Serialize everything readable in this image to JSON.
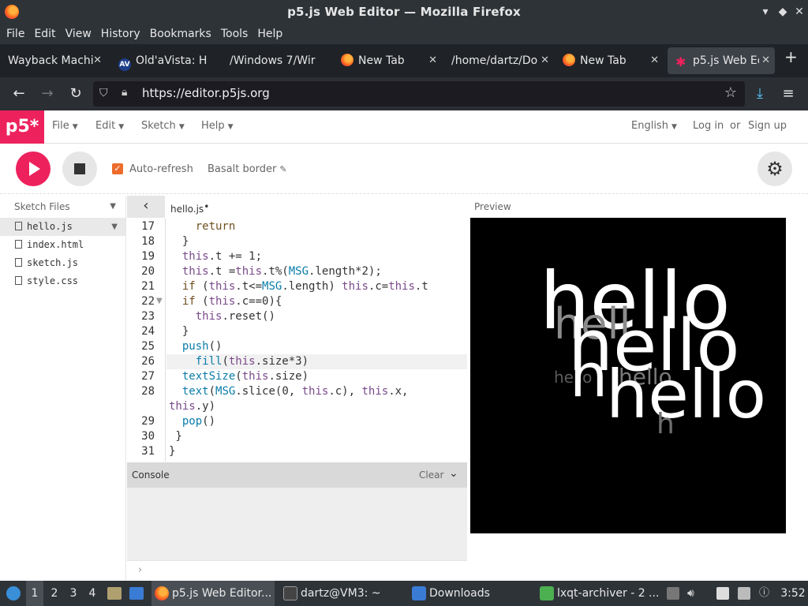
{
  "window": {
    "title": "p5.js Web Editor — Mozilla Firefox"
  },
  "menubar": [
    "File",
    "Edit",
    "View",
    "History",
    "Bookmarks",
    "Tools",
    "Help"
  ],
  "tabs": [
    {
      "label": "Wayback Machi",
      "favicon": "none"
    },
    {
      "label": "Old'aVista: H",
      "favicon": "av"
    },
    {
      "label": "/Windows 7/Wir",
      "favicon": "none"
    },
    {
      "label": "New Tab",
      "favicon": "firefox"
    },
    {
      "label": "/home/dartz/Do",
      "favicon": "none"
    },
    {
      "label": "New Tab",
      "favicon": "firefox"
    },
    {
      "label": "p5.js Web Ed",
      "favicon": "p5",
      "active": true
    }
  ],
  "url": "https://editor.p5js.org",
  "p5header": {
    "logo": "p5*",
    "menus": [
      "File",
      "Edit",
      "Sketch",
      "Help"
    ],
    "language": "English",
    "login": "Log in",
    "or": "or",
    "signup": "Sign up"
  },
  "toolbar": {
    "auto_refresh_label": "Auto-refresh",
    "auto_refresh_checked": true,
    "sketch_name": "Basalt border"
  },
  "sidebar": {
    "title": "Sketch Files",
    "files": [
      {
        "name": "hello.js",
        "selected": true
      },
      {
        "name": "index.html",
        "selected": false
      },
      {
        "name": "sketch.js",
        "selected": false
      },
      {
        "name": "style.css",
        "selected": false
      }
    ]
  },
  "editor": {
    "filename": "hello.js",
    "unsaved_marker": "•",
    "lines": [
      {
        "n": "17",
        "text": "    return"
      },
      {
        "n": "18",
        "text": "  }"
      },
      {
        "n": "19",
        "text": "  this.t += 1;"
      },
      {
        "n": "20",
        "text": "  this.t =this.t%(MSG.length*2);"
      },
      {
        "n": "21",
        "text": "  if (this.t<=MSG.length) this.c=this.t"
      },
      {
        "n": "22",
        "text": "  if (this.c==0){"
      },
      {
        "n": "23",
        "text": "    this.reset()"
      },
      {
        "n": "24",
        "text": "  }"
      },
      {
        "n": "25",
        "text": "  push()"
      },
      {
        "n": "26",
        "text": "    fill(this.size*3)"
      },
      {
        "n": "27",
        "text": "  textSize(this.size)"
      },
      {
        "n": "28",
        "text": "  text(MSG.slice(0, this.c), this.x,"
      },
      {
        "n": "",
        "text": "this.y)"
      },
      {
        "n": "29",
        "text": "  pop()"
      },
      {
        "n": "30",
        "text": " }"
      },
      {
        "n": "31",
        "text": "}"
      }
    ]
  },
  "console": {
    "title": "Console",
    "clear_label": "Clear",
    "prompt": "›"
  },
  "preview": {
    "label": "Preview",
    "texts": [
      {
        "text": "hello",
        "shade": "#ffffff"
      },
      {
        "text": "hell",
        "shade": "#8c8c8c"
      },
      {
        "text": "hello",
        "shade": "#ffffff"
      },
      {
        "text": "hello",
        "shade": "#5a5a5a"
      },
      {
        "text": "hello",
        "shade": "#7a7a7a"
      },
      {
        "text": "h",
        "shade": "#ffffff"
      },
      {
        "text": "hello",
        "shade": "#ffffff"
      },
      {
        "text": "h",
        "shade": "#6e6e6e"
      }
    ]
  },
  "taskbar": {
    "workspaces": [
      "1",
      "2",
      "3",
      "4"
    ],
    "windows": [
      {
        "label": "p5.js Web Editor...",
        "active": true
      },
      {
        "label": "dartz@VM3: ~"
      },
      {
        "label": "Downloads"
      },
      {
        "label": "lxqt-archiver - 2 ..."
      }
    ],
    "clock": "3:52"
  },
  "colors": {
    "p5_pink": "#ed225d",
    "checkbox_orange": "#ed6c2c",
    "chrome_dark": "#2e3338"
  }
}
